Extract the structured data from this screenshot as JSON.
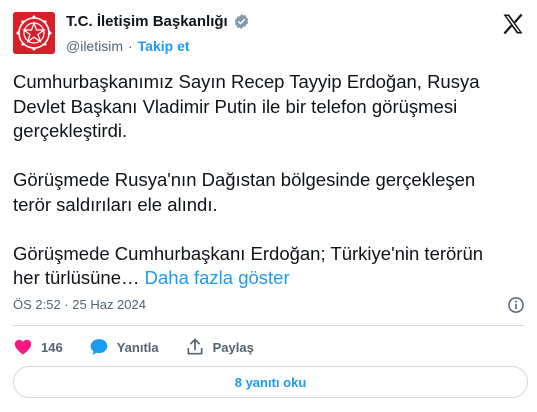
{
  "author": {
    "name": "T.C. İletişim Başkanlığı",
    "handle": "@iletisim",
    "separator": "·",
    "follow_label": "Takip et"
  },
  "tweet": {
    "lines": [
      "Cumhurbaşkanımız Sayın Recep Tayyip Erdoğan, Rusya",
      "Devlet Başkanı Vladimir Putin ile bir telefon görüşmesi",
      "gerçekleştirdi.",
      "Görüşmede Rusya'nın Dağıstan bölgesinde gerçekleşen",
      "terör saldırıları ele alındı.",
      "Görüşmede Cumhurbaşkanı Erdoğan; Türkiye'nin terörün",
      "her türlüsüne…"
    ],
    "show_more": "Daha fazla göster"
  },
  "meta": {
    "timestamp": "ÖS 2:52 · 25 Haz 2024"
  },
  "actions": {
    "like_count": "146",
    "reply_label": "Yanıtla",
    "share_label": "Paylaş"
  },
  "read_replies": "8 yanıtı oku",
  "icons": {
    "verified": "verified-gray-badge-icon",
    "platform": "x-logo-icon",
    "info": "info-icon",
    "like": "heart-icon",
    "reply": "speech-bubble-icon",
    "share": "share-upload-icon"
  },
  "colors": {
    "accent": "#1d9bf0",
    "like": "#f91880",
    "avatar_bg": "#d8202a",
    "verified": "#829aab",
    "text_primary": "#0f1419",
    "text_secondary": "#536471"
  }
}
